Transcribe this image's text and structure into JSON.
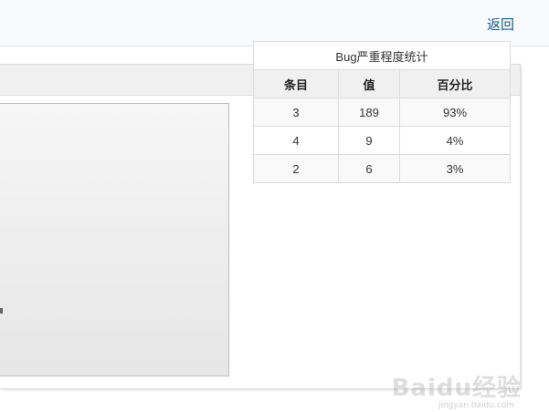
{
  "topbar": {
    "back_label": "返回"
  },
  "stats_table": {
    "caption": "Bug严重程度统计",
    "headers": [
      "条目",
      "值",
      "百分比"
    ],
    "rows": [
      [
        "3",
        "189",
        "93%"
      ],
      [
        "4",
        "9",
        "4%"
      ],
      [
        "2",
        "6",
        "3%"
      ]
    ]
  },
  "watermark": {
    "text": "Baidu经验",
    "sub": "jingyan.baidu.com"
  }
}
